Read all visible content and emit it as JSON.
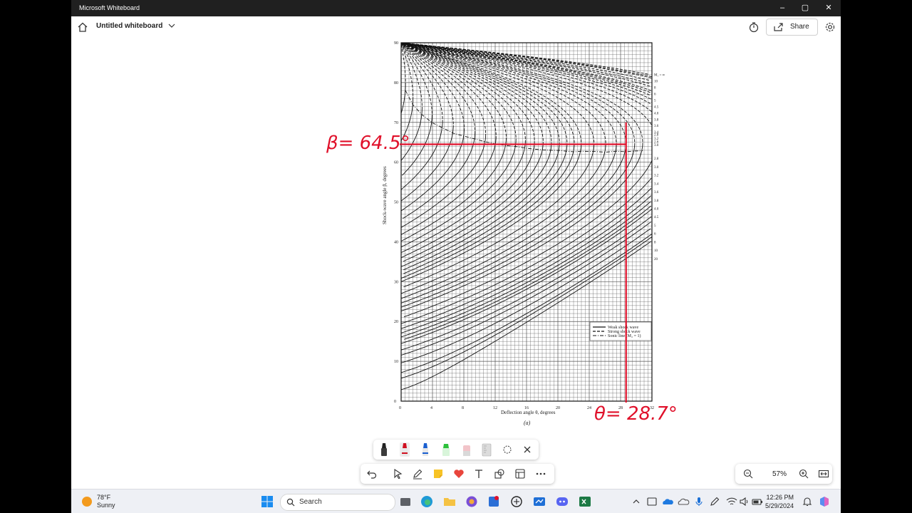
{
  "window": {
    "title": "Microsoft Whiteboard",
    "minimize": "–",
    "maximize": "▢",
    "close": "✕"
  },
  "appbar": {
    "doc_title": "Untitled whiteboard",
    "share_label": "Share"
  },
  "chart_data": {
    "type": "line",
    "title": "",
    "caption": "(a)",
    "xlabel": "Deflection angle θ, degrees",
    "ylabel": "Shock-wave angle β, degrees",
    "x_ticks": [
      "0",
      "4",
      "8",
      "12",
      "16",
      "20",
      "24",
      "28",
      "32"
    ],
    "y_ticks": [
      "0",
      "10",
      "20",
      "30",
      "40",
      "50",
      "60",
      "70",
      "80",
      "90"
    ],
    "xlim": [
      0,
      32
    ],
    "ylim": [
      0,
      90
    ],
    "grid": true,
    "mach_labels_right": [
      "M₁ = ∞",
      "10",
      "8",
      "6",
      "5",
      "4.5",
      "4.0",
      "3.8",
      "3.6",
      "3.4",
      "3.2",
      "3.0",
      "2.8",
      "2.6",
      "2.8",
      "3.0",
      "3.2",
      "3.4",
      "3.6",
      "3.8",
      "4.0",
      "4.5",
      "5",
      "6",
      "8",
      "10",
      "20"
    ],
    "legend": [
      "Weak shock wave",
      "Strong shock wave",
      "Sonic line (M₂ = 1)"
    ],
    "legend_position": "bottom-right",
    "series": [
      {
        "name": "Weak shock wave",
        "style": "solid"
      },
      {
        "name": "Strong shock wave",
        "style": "dashed"
      },
      {
        "name": "Sonic line (M₂ = 1)",
        "style": "dash-dot"
      }
    ],
    "annotations": [
      {
        "text": "β= 64.5°",
        "y": 64.5
      },
      {
        "text": "θ= 28.7°",
        "x": 28.7
      }
    ],
    "accent": "#e0102a"
  },
  "zoom": {
    "value": "57%"
  },
  "taskbar": {
    "weather_temp": "78°F",
    "weather_desc": "Sunny",
    "search_label": "Search",
    "time": "12:26 PM",
    "date": "5/29/2024"
  }
}
